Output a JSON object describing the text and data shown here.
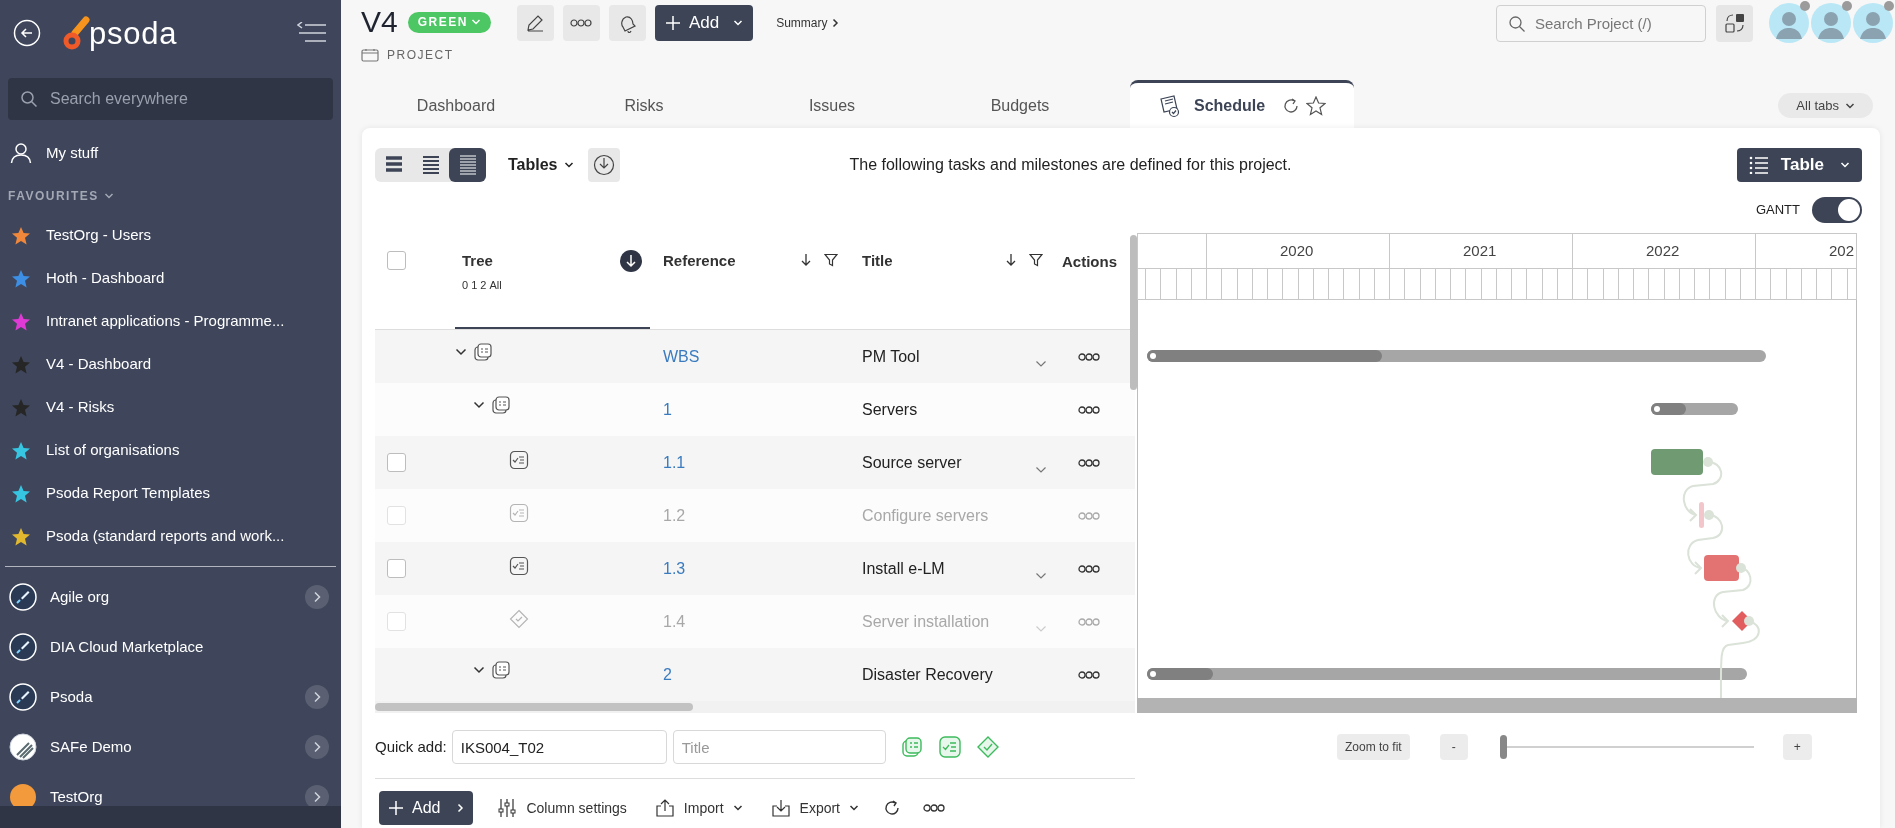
{
  "sidebar": {
    "logo_text": "psoda",
    "search_placeholder": "Search everywhere",
    "my_stuff": "My stuff",
    "favourites_heading": "FAVOURITES",
    "favourites": [
      {
        "label": "TestOrg - Users",
        "color": "#f0873a"
      },
      {
        "label": "Hoth - Dashboard",
        "color": "#3d8fe6"
      },
      {
        "label": "Intranet applications - Programme...",
        "color": "#e03ad6"
      },
      {
        "label": "V4 - Dashboard",
        "color": "#262626"
      },
      {
        "label": "V4 - Risks",
        "color": "#262626"
      },
      {
        "label": "List of organisations",
        "color": "#36c6e2"
      },
      {
        "label": "Psoda Report Templates",
        "color": "#36c6e2"
      },
      {
        "label": "Psoda (standard reports and work...",
        "color": "#e2b92e"
      }
    ],
    "organisations": [
      {
        "label": "Agile org",
        "kind": "rocket",
        "has_children": true
      },
      {
        "label": "DIA Cloud Marketplace",
        "kind": "rocket",
        "has_children": false
      },
      {
        "label": "Psoda",
        "kind": "rocket",
        "has_children": true
      },
      {
        "label": "SAFe Demo",
        "kind": "stripes",
        "has_children": true
      },
      {
        "label": "TestOrg",
        "kind": "sunset",
        "has_children": true
      }
    ]
  },
  "header": {
    "title": "V4",
    "status": "GREEN",
    "type_label": "PROJECT",
    "add_button": "Add",
    "breadcrumb": "Summary",
    "search_placeholder": "Search Project (/)",
    "avatars": [
      {
        "online": false
      },
      {
        "online": false
      },
      {
        "online": false
      }
    ]
  },
  "tabs": [
    {
      "label": "Dashboard",
      "selected": false
    },
    {
      "label": "Risks",
      "selected": false
    },
    {
      "label": "Issues",
      "selected": false
    },
    {
      "label": "Budgets",
      "selected": false
    },
    {
      "label": "Schedule",
      "selected": true
    }
  ],
  "all_tabs": "All tabs",
  "toolbar": {
    "view_modes": [
      {
        "kind": "wide",
        "selected": false
      },
      {
        "kind": "medium",
        "selected": false
      },
      {
        "kind": "narrow",
        "selected": true
      }
    ],
    "tables_label": "Tables",
    "description": "The following tasks and milestones are defined for this project.",
    "view_button": "Table",
    "gantt_label": "GANTT",
    "gantt_on": true
  },
  "table": {
    "select_all": false,
    "columns": {
      "tree": "Tree",
      "tree_levels": [
        "0",
        "1",
        "2",
        "All"
      ],
      "reference": "Reference",
      "title": "Title",
      "actions": "Actions"
    },
    "rows": [
      {
        "kind": "summary",
        "reference": "WBS",
        "title": "PM Tool",
        "expanded": true,
        "title_menu": true,
        "level": 0.38,
        "children": [
          {
            "kind": "summary",
            "reference": "1",
            "title": "Servers",
            "expanded": true,
            "title_menu": false,
            "level": 0.4,
            "children": [
              {
                "kind": "task",
                "reference": "1.1",
                "title": "Source server",
                "checked": false,
                "disabled": false,
                "title_menu": true,
                "color": "#6f9a72"
              },
              {
                "kind": "task",
                "reference": "1.2",
                "title": "Configure servers",
                "checked": false,
                "disabled": true,
                "title_menu": false,
                "color": "#f2c6ca"
              },
              {
                "kind": "task",
                "reference": "1.3",
                "title": "Install e-LM",
                "checked": false,
                "disabled": false,
                "title_menu": true,
                "color": "#e37373"
              },
              {
                "kind": "milestone",
                "reference": "1.4",
                "title": "Server installation",
                "checked": false,
                "disabled": true,
                "title_menu": true,
                "color": "#e25d5d"
              }
            ]
          },
          {
            "kind": "summary",
            "reference": "2",
            "title": "Disaster Recovery",
            "expanded": true,
            "title_menu": false,
            "level": 0.11
          }
        ]
      }
    ]
  },
  "gantt": {
    "years": [
      "2020",
      "2021",
      "2022",
      "202"
    ]
  },
  "quick_add": {
    "label": "Quick add:",
    "reference_value": "IKS004_T02",
    "title_placeholder": "Title"
  },
  "zoom": {
    "fit_label": "Zoom to fit",
    "minus": "-",
    "plus": "+",
    "level": 0
  },
  "bottom_toolbar": {
    "add": "Add",
    "column_settings": "Column settings",
    "import": "Import",
    "export": "Export"
  }
}
